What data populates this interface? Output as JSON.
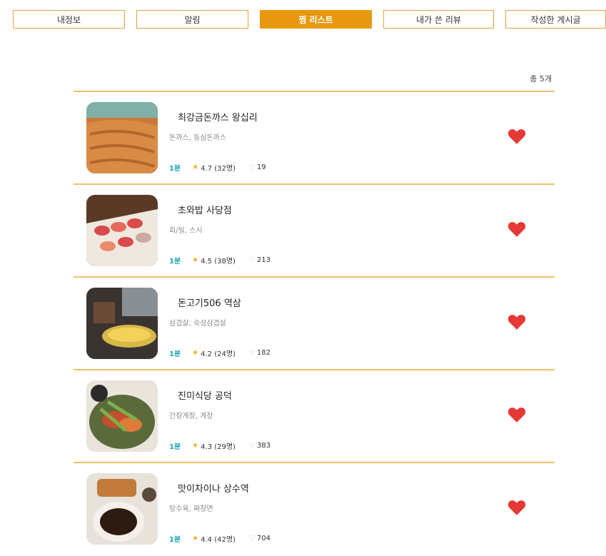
{
  "tabs": [
    {
      "label": "내정보",
      "active": false
    },
    {
      "label": "알림",
      "active": false
    },
    {
      "label": "찜 리스트",
      "active": true
    },
    {
      "label": "내가 쓴 리뷰",
      "active": false
    },
    {
      "label": "작성한 게시글",
      "active": false
    }
  ],
  "total_text": "총 5개",
  "accent_color": "#e8980f",
  "heart_color": "#e53935",
  "restaurants": [
    {
      "name": "최강금돈까스 왕십리",
      "category": "돈까스, 등심돈까스",
      "distance": "1분",
      "rating": "4.7 (32명)",
      "likes": "19",
      "thumb": "tonkatsu"
    },
    {
      "name": "초와밥 사당점",
      "category": "회/일, 스시",
      "distance": "1분",
      "rating": "4.5 (38명)",
      "likes": "213",
      "thumb": "sushi"
    },
    {
      "name": "돈고기506 역삼",
      "category": "삼겹살, 숙성삼겹살",
      "distance": "1분",
      "rating": "4.2 (24명)",
      "likes": "182",
      "thumb": "bbq"
    },
    {
      "name": "진미식당 공덕",
      "category": "간장게장, 게장",
      "distance": "1분",
      "rating": "4.3 (29명)",
      "likes": "383",
      "thumb": "crab"
    },
    {
      "name": "맛이차이나 상수역",
      "category": "탕수육, 짜장면",
      "distance": "1분",
      "rating": "4.4 (42명)",
      "likes": "704",
      "thumb": "chinese"
    }
  ]
}
